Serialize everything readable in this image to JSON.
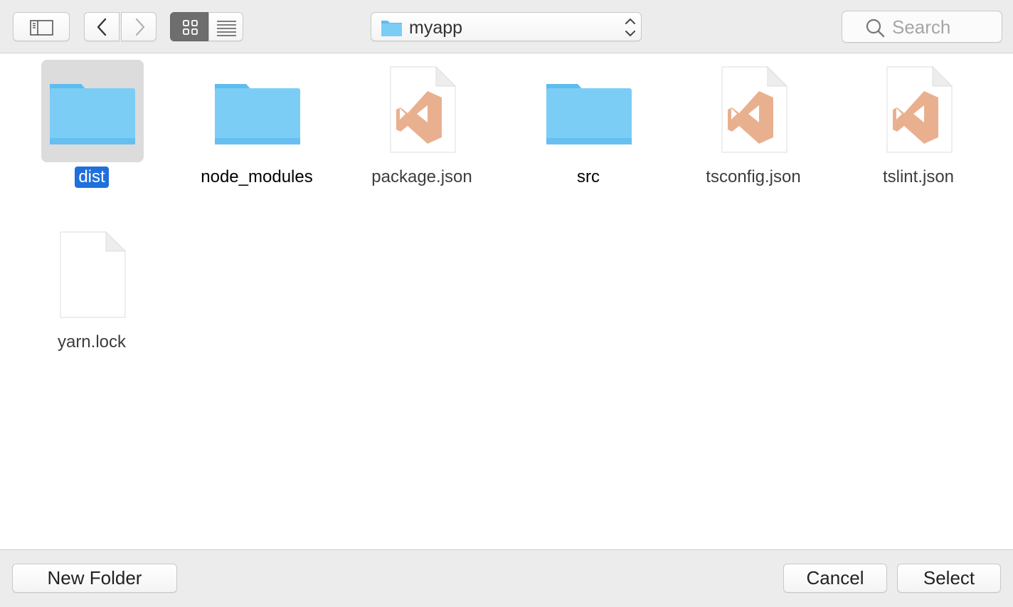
{
  "toolbar": {
    "location": "myapp",
    "search_placeholder": "Search"
  },
  "files": [
    {
      "name": "dist",
      "kind": "folder",
      "selected": true
    },
    {
      "name": "node_modules",
      "kind": "folder",
      "selected": false
    },
    {
      "name": "package.json",
      "kind": "vscode-document",
      "selected": false
    },
    {
      "name": "src",
      "kind": "folder",
      "selected": false
    },
    {
      "name": "tsconfig.json",
      "kind": "vscode-document",
      "selected": false
    },
    {
      "name": "tslint.json",
      "kind": "vscode-document",
      "selected": false
    },
    {
      "name": "yarn.lock",
      "kind": "blank-document",
      "selected": false
    }
  ],
  "footer": {
    "new_folder_label": "New Folder",
    "cancel_label": "Cancel",
    "select_label": "Select"
  },
  "colors": {
    "folder": "#7ccdf6",
    "selection": "#1f6fdc",
    "vscode_icon": "#e9b08f"
  }
}
